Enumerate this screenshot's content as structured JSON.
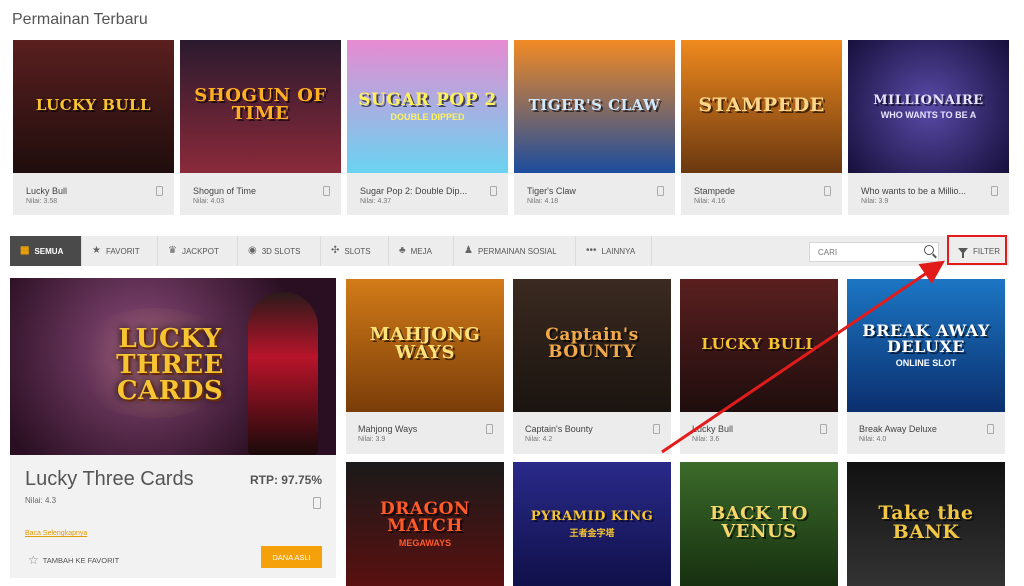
{
  "section_title": "Permainan Terbaru",
  "new_games": [
    {
      "name": "Lucky Bull",
      "rating": "Nilai: 3.58",
      "art": "LUCKY BULL",
      "sub": "",
      "bg": "linear-gradient(180deg,#5a1f1f,#1f0d0d)",
      "fg": "#f7c531",
      "size": "15px"
    },
    {
      "name": "Shogun of Time",
      "rating": "Nilai: 4.03",
      "art": "SHOGUN OF TIME",
      "sub": "",
      "bg": "linear-gradient(180deg,#2b1a2e,#8a2a3a)",
      "fg": "#ffb020",
      "size": "18px"
    },
    {
      "name": "Sugar Pop 2: Double Dip...",
      "rating": "Nilai: 4.37",
      "art": "SUGAR POP 2",
      "sub": "DOUBLE DIPPED",
      "bg": "linear-gradient(180deg,#e78bd2,#6ad3f1)",
      "fg": "#fff15a",
      "size": "17px"
    },
    {
      "name": "Tiger's Claw",
      "rating": "Nilai: 4.18",
      "art": "TIGER'S CLAW",
      "sub": "",
      "bg": "linear-gradient(180deg,#f28a24,#1c4d9e)",
      "fg": "#cfe9ff",
      "size": "15px"
    },
    {
      "name": "Stampede",
      "rating": "Nilai: 4.16",
      "art": "STAMPEDE",
      "sub": "",
      "bg": "linear-gradient(180deg,#f08a1e,#6b3810)",
      "fg": "#ffd78a",
      "size": "19px"
    },
    {
      "name": "Who wants to be a Millio...",
      "rating": "Nilai: 3.9",
      "art": "MILLIONAIRE",
      "sub": "WHO WANTS TO BE A",
      "bg": "radial-gradient(circle,#5a4aa8,#160f3a)",
      "fg": "#e8e4ff",
      "size": "13px"
    }
  ],
  "tabs": [
    {
      "label": "SEMUA",
      "icon": "▦",
      "active": true
    },
    {
      "label": "FAVORIT",
      "icon": "★"
    },
    {
      "label": "JACKPOT",
      "icon": "♛"
    },
    {
      "label": "3D SLOTS",
      "icon": "◉"
    },
    {
      "label": "SLOTS",
      "icon": "✣"
    },
    {
      "label": "MEJA",
      "icon": "♣"
    },
    {
      "label": "PERMAINAN SOSIAL",
      "icon": "♟"
    },
    {
      "label": "LAINNYA",
      "icon": "•••"
    }
  ],
  "search": {
    "placeholder": "CARI"
  },
  "filter_label": "FILTER",
  "featured": {
    "name": "Lucky Three Cards",
    "rtp": "RTP: 97.75%",
    "rating": "Nilai: 4.3",
    "read_more": "Baca Selengkapnya",
    "favorite": "TAMBAH KE FAVORIT",
    "play": "DANA ASLI",
    "art": "LUCKY THREE CARDS"
  },
  "grid_games": [
    {
      "name": "Mahjong Ways",
      "rating": "Nilai: 3.9",
      "art": "MAHJONG WAYS",
      "sub": "",
      "bg": "linear-gradient(180deg,#d27b18,#7a3d09)",
      "fg": "#ffe27a",
      "size": "18px"
    },
    {
      "name": "Captain's Bounty",
      "rating": "Nilai: 4.2",
      "art": "Captain's BOUNTY",
      "sub": "",
      "bg": "linear-gradient(180deg,#3b2a20,#1a1410)",
      "fg": "#f1a94a",
      "size": "17px"
    },
    {
      "name": "Lucky Bull",
      "rating": "Nilai: 3.6",
      "art": "LUCKY BULL",
      "sub": "",
      "bg": "linear-gradient(180deg,#5a1f1f,#1f0d0d)",
      "fg": "#f7c531",
      "size": "15px"
    },
    {
      "name": "Break Away Deluxe",
      "rating": "Nilai: 4.0",
      "art": "BREAK AWAY DELUXE",
      "sub": "ONLINE SLOT",
      "bg": "linear-gradient(180deg,#1c76c4,#0b2f6e)",
      "fg": "#ffffff",
      "size": "16px"
    },
    {
      "name": "",
      "rating": "",
      "art": "DRAGON MATCH",
      "sub": "MEGAWAYS",
      "bg": "linear-gradient(180deg,#1a1a1a,#5a1010)",
      "fg": "#ff5a2a",
      "size": "17px"
    },
    {
      "name": "",
      "rating": "",
      "art": "PYRAMID KING",
      "sub": "王者金字塔",
      "bg": "linear-gradient(180deg,#2a2a8a,#10104a)",
      "fg": "#f7c531",
      "size": "13px"
    },
    {
      "name": "",
      "rating": "",
      "art": "BACK TO VENUS",
      "sub": "",
      "bg": "linear-gradient(180deg,#3c6b2a,#163010)",
      "fg": "#f4d66a",
      "size": "18px"
    },
    {
      "name": "",
      "rating": "",
      "art": "Take the BANK",
      "sub": "",
      "bg": "linear-gradient(180deg,#111,#333)",
      "fg": "#f2c744",
      "size": "19px"
    }
  ],
  "colors": {
    "accent": "#f4a10c",
    "annotation": "#e21b1b",
    "tab_active": "#4a4a4a"
  }
}
